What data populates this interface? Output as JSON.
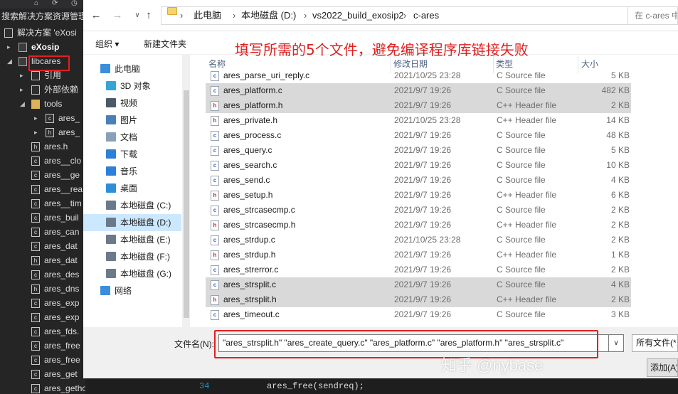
{
  "vs": {
    "top_icons": [
      "⌂",
      "⟳",
      "◷"
    ],
    "search_text": "搜索解决方案资源管理",
    "tree": [
      {
        "label": "解决方案 'eXosi",
        "indent": 8,
        "arrow": "",
        "icon": "solution-icon",
        "bold": false
      },
      {
        "label": "eXosip",
        "indent": 28,
        "arrow": "▸",
        "icon": "project-icon",
        "bold": true
      },
      {
        "label": "libcares",
        "indent": 28,
        "arrow": "◢",
        "icon": "project-icon",
        "bold": false
      },
      {
        "label": "引用",
        "indent": 46,
        "arrow": "▸",
        "icon": "references-icon",
        "bold": false
      },
      {
        "label": "外部依赖",
        "indent": 46,
        "arrow": "▸",
        "icon": "external-deps-icon",
        "bold": false
      },
      {
        "label": "tools",
        "indent": 46,
        "arrow": "◢",
        "icon": "folder-icon",
        "bold": false
      },
      {
        "label": "ares_",
        "indent": 66,
        "arrow": "▸",
        "icon": "c-file-icon",
        "bold": false
      },
      {
        "label": "ares_",
        "indent": 66,
        "arrow": "▸",
        "icon": "h-file-icon",
        "bold": false
      },
      {
        "label": "ares.h",
        "indent": 46,
        "arrow": "",
        "icon": "h-file-icon",
        "bold": false
      },
      {
        "label": "ares__clo",
        "indent": 46,
        "arrow": "",
        "icon": "c-file-icon",
        "bold": false
      },
      {
        "label": "ares__ge",
        "indent": 46,
        "arrow": "",
        "icon": "c-file-icon",
        "bold": false
      },
      {
        "label": "ares__rea",
        "indent": 46,
        "arrow": "",
        "icon": "c-file-icon",
        "bold": false
      },
      {
        "label": "ares__tim",
        "indent": 46,
        "arrow": "",
        "icon": "c-file-icon",
        "bold": false
      },
      {
        "label": "ares_buil",
        "indent": 46,
        "arrow": "",
        "icon": "c-file-icon",
        "bold": false
      },
      {
        "label": "ares_can",
        "indent": 46,
        "arrow": "",
        "icon": "c-file-icon",
        "bold": false
      },
      {
        "label": "ares_dat",
        "indent": 46,
        "arrow": "",
        "icon": "c-file-icon",
        "bold": false
      },
      {
        "label": "ares_dat",
        "indent": 46,
        "arrow": "",
        "icon": "h-file-icon",
        "bold": false
      },
      {
        "label": "ares_des",
        "indent": 46,
        "arrow": "",
        "icon": "c-file-icon",
        "bold": false
      },
      {
        "label": "ares_dns",
        "indent": 46,
        "arrow": "",
        "icon": "h-file-icon",
        "bold": false
      },
      {
        "label": "ares_exp",
        "indent": 46,
        "arrow": "",
        "icon": "c-file-icon",
        "bold": false
      },
      {
        "label": "ares_exp",
        "indent": 46,
        "arrow": "",
        "icon": "c-file-icon",
        "bold": false
      },
      {
        "label": "ares_fds.",
        "indent": 46,
        "arrow": "",
        "icon": "c-file-icon",
        "bold": false
      },
      {
        "label": "ares_free",
        "indent": 46,
        "arrow": "",
        "icon": "c-file-icon",
        "bold": false
      },
      {
        "label": "ares_free",
        "indent": 46,
        "arrow": "",
        "icon": "c-file-icon",
        "bold": false
      },
      {
        "label": "ares_get",
        "indent": 46,
        "arrow": "",
        "icon": "c-file-icon",
        "bold": false
      },
      {
        "label": "ares_gethostbyname.c",
        "indent": 46,
        "arrow": "",
        "icon": "c-file-icon",
        "bold": false
      }
    ],
    "code_line_number": "34",
    "code_text": "ares_free(sendreq);"
  },
  "dialog": {
    "nav": {
      "back": "←",
      "forward": "→",
      "up": "↑"
    },
    "breadcrumb": [
      "此电脑",
      "本地磁盘 (D:)",
      "vs2022_build_exosip2",
      "c-ares"
    ],
    "breadcrumb_sep": "›",
    "refresh": "↻",
    "search_placeholder": "在 c-ares 中",
    "toolbar": {
      "organize": "组织 ▾",
      "new_folder": "新建文件夹"
    },
    "annotation": "填写所需的5个文件，避免编译程序库链接失败",
    "nav_items": [
      {
        "label": "此电脑",
        "icon": "computer-icon",
        "color": "#3b8edb",
        "indent": 24,
        "selected": false
      },
      {
        "label": "3D 对象",
        "icon": "3d-objects-icon",
        "color": "#35a4d8",
        "indent": 32,
        "selected": false
      },
      {
        "label": "视频",
        "icon": "video-icon",
        "color": "#4a5a6a",
        "indent": 32,
        "selected": false
      },
      {
        "label": "图片",
        "icon": "pictures-icon",
        "color": "#4a7fb8",
        "indent": 32,
        "selected": false
      },
      {
        "label": "文档",
        "icon": "documents-icon",
        "color": "#8aa0b8",
        "indent": 32,
        "selected": false
      },
      {
        "label": "下载",
        "icon": "downloads-icon",
        "color": "#2d7fd8",
        "indent": 32,
        "selected": false
      },
      {
        "label": "音乐",
        "icon": "music-icon",
        "color": "#2d7fd8",
        "indent": 32,
        "selected": false
      },
      {
        "label": "桌面",
        "icon": "desktop-icon",
        "color": "#2d8fd8",
        "indent": 32,
        "selected": false
      },
      {
        "label": "本地磁盘 (C:)",
        "icon": "drive-c-icon",
        "color": "#6a7a8a",
        "indent": 32,
        "selected": false
      },
      {
        "label": "本地磁盘 (D:)",
        "icon": "drive-d-icon",
        "color": "#6a7a8a",
        "indent": 32,
        "selected": true
      },
      {
        "label": "本地磁盘 (E:)",
        "icon": "drive-e-icon",
        "color": "#6a7a8a",
        "indent": 32,
        "selected": false
      },
      {
        "label": "本地磁盘 (F:)",
        "icon": "drive-f-icon",
        "color": "#6a7a8a",
        "indent": 32,
        "selected": false
      },
      {
        "label": "本地磁盘 (G:)",
        "icon": "drive-g-icon",
        "color": "#6a7a8a",
        "indent": 32,
        "selected": false
      },
      {
        "label": "网络",
        "icon": "network-icon",
        "color": "#3b8edb",
        "indent": 24,
        "selected": false
      }
    ],
    "columns": {
      "name": "名称",
      "date": "修改日期",
      "type": "类型",
      "size": "大小"
    },
    "files": [
      {
        "name": "ares_parse_uri_reply.c",
        "date": "2021/10/25 23:28",
        "type": "C Source file",
        "size": "5 KB",
        "kind": "c",
        "selected": false
      },
      {
        "name": "ares_platform.c",
        "date": "2021/9/7 19:26",
        "type": "C Source file",
        "size": "482 KB",
        "kind": "c",
        "selected": true
      },
      {
        "name": "ares_platform.h",
        "date": "2021/9/7 19:26",
        "type": "C++ Header file",
        "size": "2 KB",
        "kind": "h",
        "selected": true
      },
      {
        "name": "ares_private.h",
        "date": "2021/10/25 23:28",
        "type": "C++ Header file",
        "size": "14 KB",
        "kind": "h",
        "selected": false
      },
      {
        "name": "ares_process.c",
        "date": "2021/9/7 19:26",
        "type": "C Source file",
        "size": "48 KB",
        "kind": "c",
        "selected": false
      },
      {
        "name": "ares_query.c",
        "date": "2021/9/7 19:26",
        "type": "C Source file",
        "size": "5 KB",
        "kind": "c",
        "selected": false
      },
      {
        "name": "ares_search.c",
        "date": "2021/9/7 19:26",
        "type": "C Source file",
        "size": "10 KB",
        "kind": "c",
        "selected": false
      },
      {
        "name": "ares_send.c",
        "date": "2021/9/7 19:26",
        "type": "C Source file",
        "size": "4 KB",
        "kind": "c",
        "selected": false
      },
      {
        "name": "ares_setup.h",
        "date": "2021/9/7 19:26",
        "type": "C++ Header file",
        "size": "6 KB",
        "kind": "h",
        "selected": false
      },
      {
        "name": "ares_strcasecmp.c",
        "date": "2021/9/7 19:26",
        "type": "C Source file",
        "size": "2 KB",
        "kind": "c",
        "selected": false
      },
      {
        "name": "ares_strcasecmp.h",
        "date": "2021/9/7 19:26",
        "type": "C++ Header file",
        "size": "2 KB",
        "kind": "h",
        "selected": false
      },
      {
        "name": "ares_strdup.c",
        "date": "2021/10/25 23:28",
        "type": "C Source file",
        "size": "2 KB",
        "kind": "c",
        "selected": false
      },
      {
        "name": "ares_strdup.h",
        "date": "2021/9/7 19:26",
        "type": "C++ Header file",
        "size": "1 KB",
        "kind": "h",
        "selected": false
      },
      {
        "name": "ares_strerror.c",
        "date": "2021/9/7 19:26",
        "type": "C Source file",
        "size": "2 KB",
        "kind": "c",
        "selected": false
      },
      {
        "name": "ares_strsplit.c",
        "date": "2021/9/7 19:26",
        "type": "C Source file",
        "size": "4 KB",
        "kind": "c",
        "selected": true
      },
      {
        "name": "ares_strsplit.h",
        "date": "2021/9/7 19:26",
        "type": "C++ Header file",
        "size": "2 KB",
        "kind": "h",
        "selected": true
      },
      {
        "name": "ares_timeout.c",
        "date": "2021/9/7 19:26",
        "type": "C Source file",
        "size": "3 KB",
        "kind": "c",
        "selected": false
      }
    ],
    "filename_label": "文件名(N):",
    "filename_value": "\"ares_strsplit.h\" \"ares_create_query.c\" \"ares_platform.c\" \"ares_platform.h\" \"ares_strsplit.c\"",
    "filetype_value": "所有文件(*.",
    "open_button": "添加(A)"
  },
  "watermark": "知乎 @nybase",
  "colors": {
    "annotation": "#e02020",
    "selection": "#d9d9d9",
    "nav_selection": "#cce8ff"
  }
}
